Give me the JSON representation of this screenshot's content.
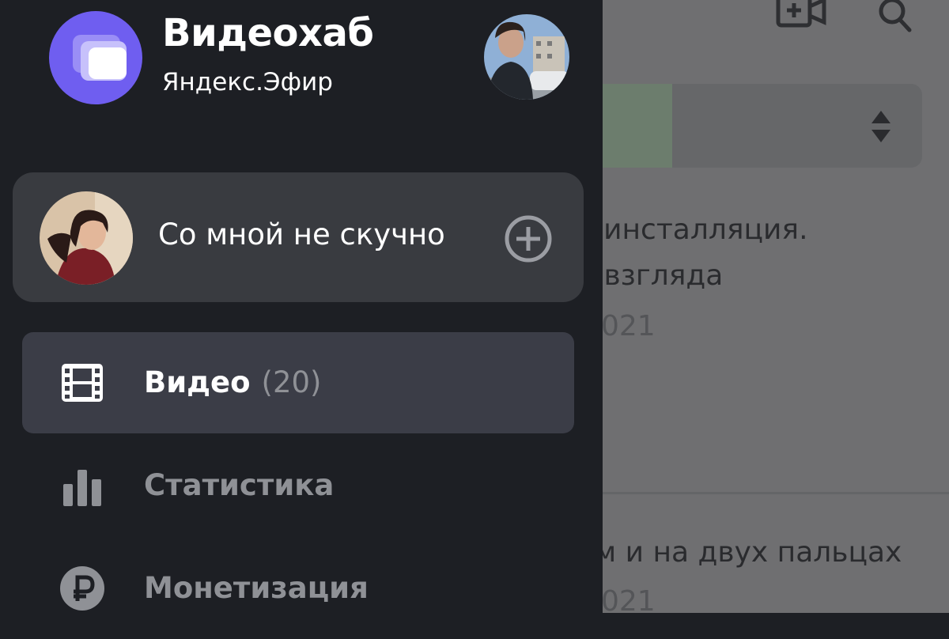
{
  "app": {
    "title": "Видеохаб",
    "subtitle": "Яндекс.Эфир"
  },
  "channel": {
    "name": "Со мной не скучно"
  },
  "nav": {
    "items": [
      {
        "label": "Видео",
        "count": "(20)",
        "icon": "film-icon",
        "active": true
      },
      {
        "label": "Статистика",
        "count": "",
        "icon": "bar-chart-icon",
        "active": false
      },
      {
        "label": "Монетизация",
        "count": "",
        "icon": "ruble-icon",
        "active": false
      }
    ]
  },
  "background": {
    "video1_line1": "я инсталляция.",
    "video1_line2": "о взгляда",
    "video1_date": "021",
    "video2_title": "ом и на двух пальцах",
    "video2_date": "021"
  },
  "colors": {
    "accent": "#6f5ef0",
    "drawer_bg": "#1d1f24",
    "card_bg": "#393b40",
    "active_item_bg": "#3b3d47"
  }
}
